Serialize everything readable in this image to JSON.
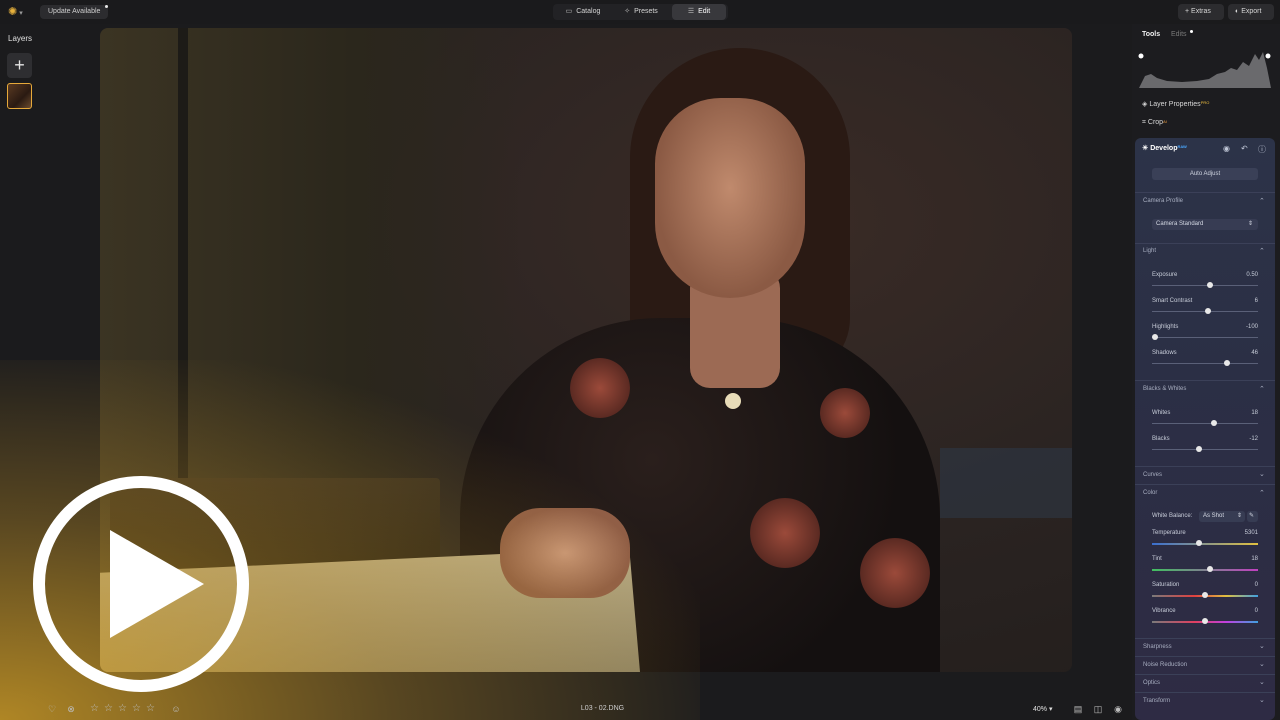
{
  "topbar": {
    "logo_icon": "sun-logo",
    "update_label": "Update Available",
    "tabs": [
      {
        "label": "Catalog",
        "icon": "folder-icon"
      },
      {
        "label": "Presets",
        "icon": "sparkle-icon"
      },
      {
        "label": "Edit",
        "icon": "sliders-icon",
        "active": true
      }
    ],
    "extras_label": "Extras",
    "export_label": "Export"
  },
  "left_panel": {
    "title": "Layers",
    "add_label": "+"
  },
  "bottombar": {
    "filename": "L03 - 02.DNG",
    "zoom": "40%",
    "rating": 0,
    "stars_max": 5
  },
  "right_panel": {
    "tabs": [
      "Tools",
      "Edits"
    ],
    "layer_properties": "Layer Properties",
    "layer_properties_badge": "PRO",
    "crop": "Crop",
    "crop_badge": "AI",
    "develop": {
      "title": "Develop",
      "badge": "RAW",
      "auto_adjust": "Auto Adjust",
      "camera_profile": {
        "title": "Camera Profile",
        "value": "Camera Standard"
      },
      "light": {
        "title": "Light",
        "sliders": [
          {
            "label": "Exposure",
            "value": "0.50",
            "pos": 0.55
          },
          {
            "label": "Smart Contrast",
            "value": "6",
            "pos": 0.53
          },
          {
            "label": "Highlights",
            "value": "-100",
            "pos": 0.0
          },
          {
            "label": "Shadows",
            "value": "46",
            "pos": 0.71
          }
        ]
      },
      "blacks_whites": {
        "title": "Blacks & Whites",
        "sliders": [
          {
            "label": "Whites",
            "value": "18",
            "pos": 0.58
          },
          {
            "label": "Blacks",
            "value": "-12",
            "pos": 0.44
          }
        ]
      },
      "curves": "Curves",
      "color": {
        "title": "Color",
        "white_balance_label": "White Balance:",
        "white_balance_value": "As Shot",
        "sliders": [
          {
            "label": "Temperature",
            "value": "5301",
            "pos": 0.44
          },
          {
            "label": "Tint",
            "value": "18",
            "pos": 0.55
          },
          {
            "label": "Saturation",
            "value": "0",
            "pos": 0.5
          },
          {
            "label": "Vibrance",
            "value": "0",
            "pos": 0.5
          }
        ]
      },
      "collapsed_sections": [
        "Sharpness",
        "Noise Reduction",
        "Optics",
        "Transform"
      ]
    }
  },
  "colors": {
    "accent": "#e7b13c",
    "panel": "#2c3348"
  }
}
